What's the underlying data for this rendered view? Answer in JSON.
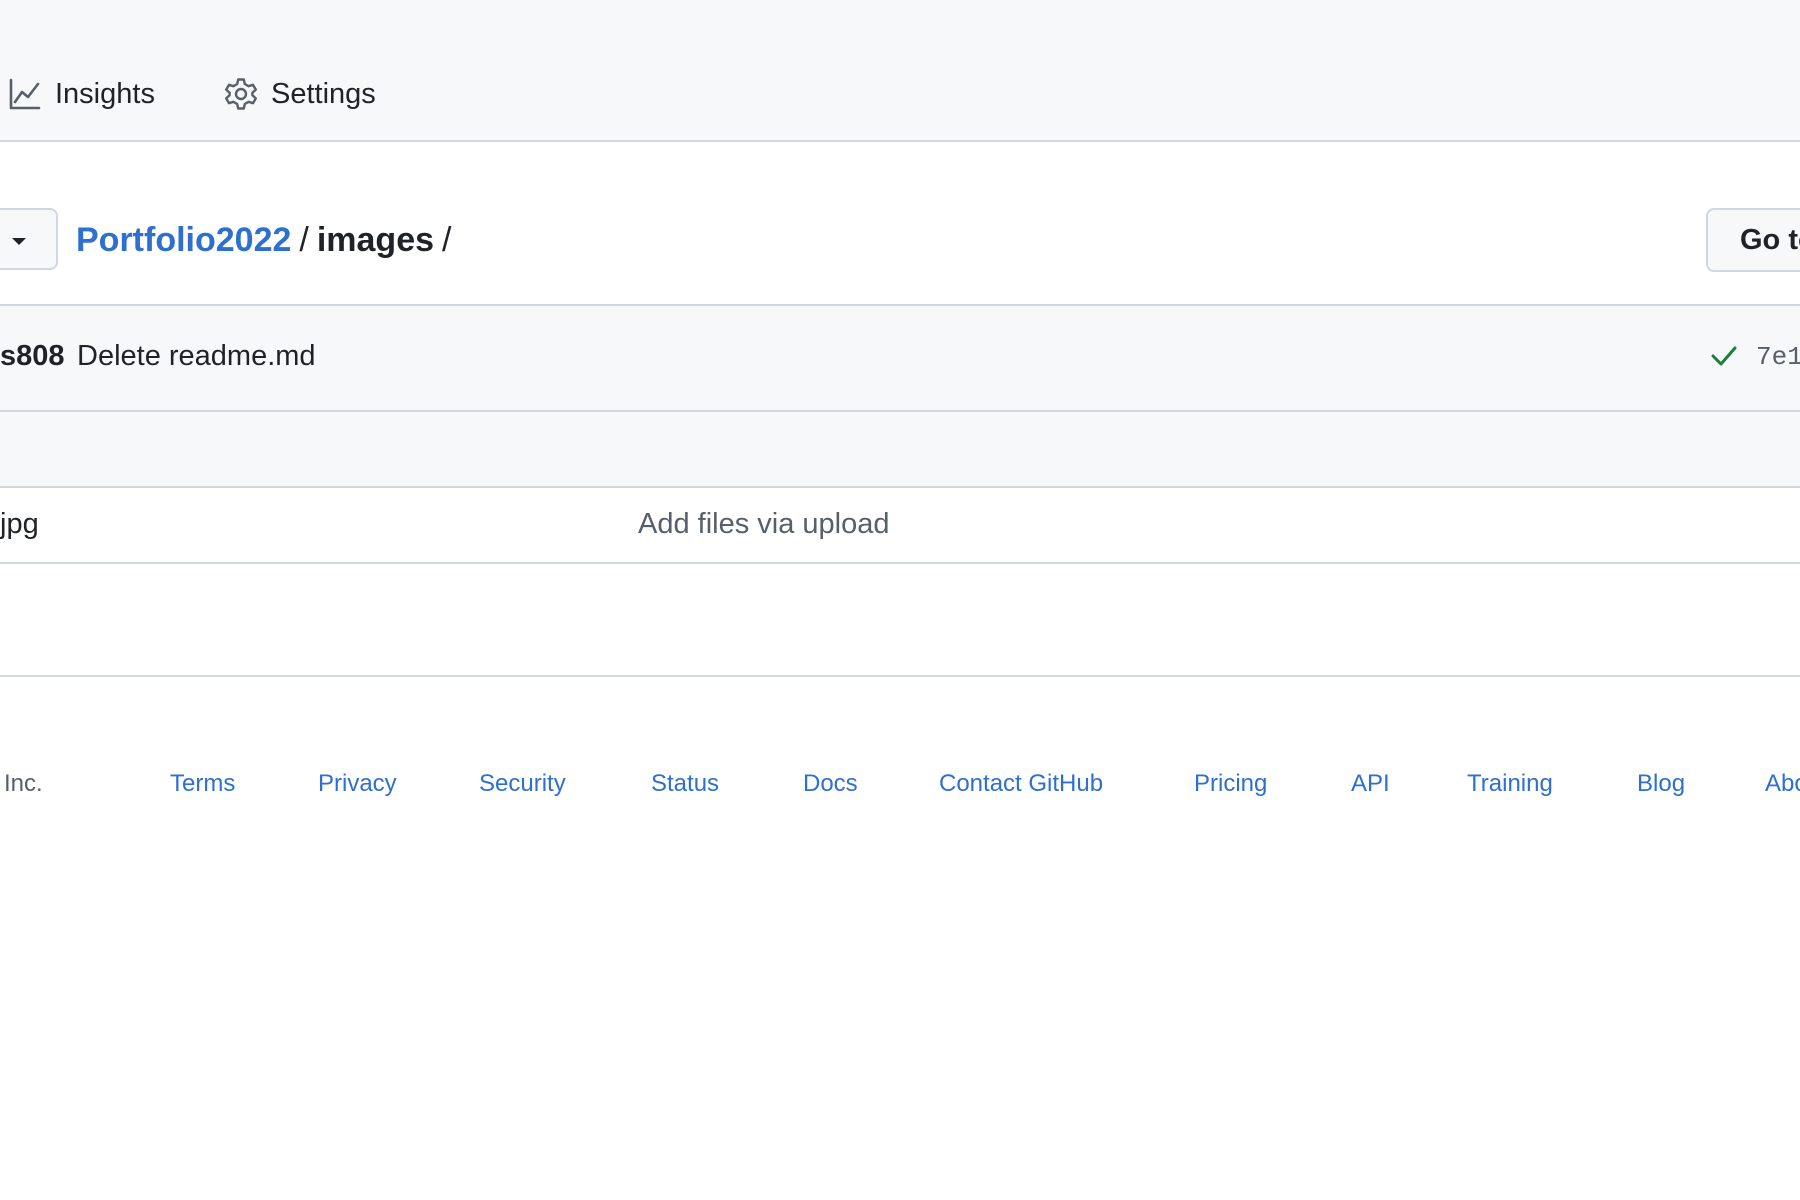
{
  "repo_nav": {
    "insights_label": "Insights",
    "settings_label": "Settings",
    "insights_icon": "graph-icon",
    "settings_icon": "gear-icon"
  },
  "breadcrumb": {
    "repo": "Portfolio2022",
    "separator": "/",
    "folder": "images",
    "trailing_separator": "/"
  },
  "toolbar": {
    "branch_caret_icon": "caret-down-icon",
    "go_to_file_label": "Go to"
  },
  "latest_commit": {
    "author": "s808",
    "message": "Delete readme.md",
    "status_icon": "check-icon",
    "status_color": "#1a7f37",
    "sha": "7e1"
  },
  "files": [
    {
      "name": "jpg",
      "last_commit": "Add files via upload"
    }
  ],
  "footer": {
    "copyright": "Inc.",
    "links": [
      "Terms",
      "Privacy",
      "Security",
      "Status",
      "Docs",
      "Contact GitHub",
      "Pricing",
      "API",
      "Training",
      "Blog",
      "Abo"
    ]
  },
  "colors": {
    "link": "#2f6fcf",
    "border": "#d0d7de",
    "subtle_bg": "#f6f8fa",
    "text": "#1f2328",
    "muted_text": "#57606a"
  }
}
